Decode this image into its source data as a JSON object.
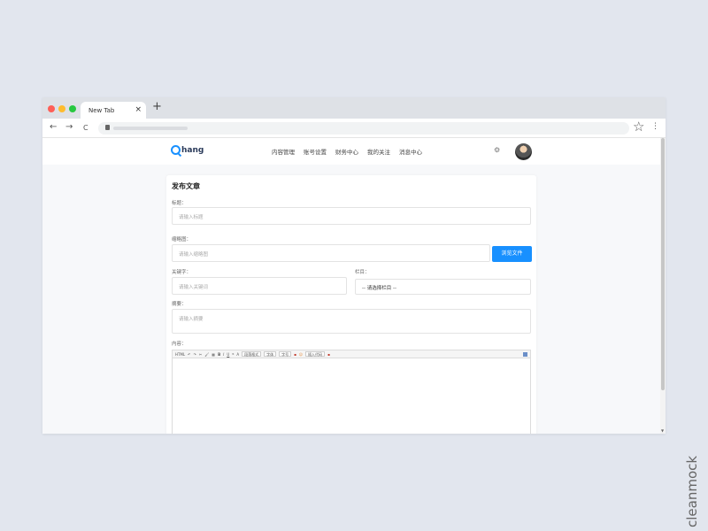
{
  "browser": {
    "tab_title": "New Tab",
    "tab_close": "×",
    "new_tab": "+",
    "back": "←",
    "forward": "→",
    "reload": "C",
    "star": "☆",
    "menu": "⋮"
  },
  "header": {
    "logo_text": "hang",
    "nav": [
      "内容管理",
      "账号设置",
      "财务中心",
      "我的关注",
      "消息中心"
    ],
    "settings_icon": "⚙"
  },
  "form": {
    "title": "发布文章",
    "title_label": "标题：",
    "title_placeholder": "请输入标题",
    "cover_label": "缩略图：",
    "cover_placeholder": "请输入缩略图",
    "upload_button": "浏览文件",
    "keywords_label": "关键字：",
    "keywords_placeholder": "请输入关键词",
    "column_label": "栏目：",
    "column_value": "-- 请选择栏目 --",
    "summary_label": "摘要：",
    "summary_placeholder": "请输入摘要",
    "content_label": "内容："
  },
  "editor_toolbar": [
    "HTML",
    "↶",
    "↷",
    "✂",
    "🖌",
    "▦",
    "B",
    "I",
    "U",
    "❝",
    "A"
  ],
  "editor_selects": [
    "段落格式",
    "字体",
    "字号"
  ],
  "editor_insert": "插入代码",
  "watermark": "cleanmock"
}
